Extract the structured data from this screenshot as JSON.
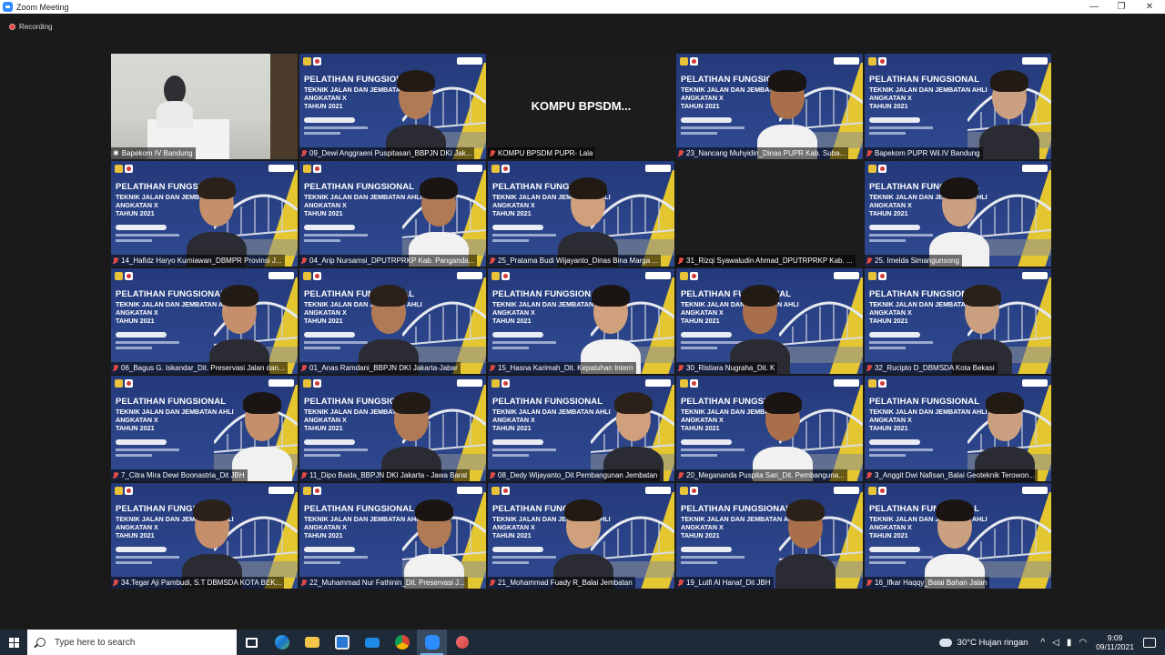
{
  "window": {
    "title": "Zoom Meeting",
    "minimize": "—",
    "restore": "❐",
    "close": "✕"
  },
  "recording": {
    "label": "Recording"
  },
  "slide": {
    "title": "PELATIHAN FUNGSIONAL",
    "line1": "TEKNIK JALAN DAN JEMBATAN AHLI",
    "line2": "ANGKATAN X",
    "line3": "TAHUN 2021"
  },
  "tiles": [
    {
      "name": "Bapekom IV Bandung",
      "type": "room",
      "active": true
    },
    {
      "name": "09_Dewi Anggraeni  Puspitasari_BBPJN DKI Jak...",
      "type": "slide"
    },
    {
      "name": "KOMPU BPSDM PUPR- Lala",
      "type": "blank",
      "center": "KOMPU  BPSDM..."
    },
    {
      "name": "23_Nancang Muhyidin_Dinas PUPR Kab. Suba...",
      "type": "slide"
    },
    {
      "name": "Bapekom PUPR Wil.IV Bandung",
      "type": "slide"
    },
    {
      "name": "14_Hafidz Haryo Kurniawan_DBMPR Provinsi J...",
      "type": "slide"
    },
    {
      "name": "04_Arip Nursamsi_DPUTRPRKP Kab. Panganda...",
      "type": "slide"
    },
    {
      "name": "25_Pratama Budi Wijayanto_Dinas Bina Marga ...",
      "type": "slide"
    },
    {
      "name": "31_Rizqi Syawaludin Ahmad_DPUTRPRKP Kab. ...",
      "type": "blank",
      "center": ""
    },
    {
      "name": "25. Imelda Simangunsong",
      "type": "slide"
    },
    {
      "name": "06_Bagus G. Iskandar_Dit. Preservasi Jalan dan...",
      "type": "slide"
    },
    {
      "name": "01_Anas Ramdani_BBPJN DKI Jakarta-Jabar",
      "type": "slide"
    },
    {
      "name": "15_Hasna Karimah_Dit. Kepatuhan Intern",
      "type": "slide"
    },
    {
      "name": "30_Ristiara Nugraha_Dit. K",
      "type": "slide"
    },
    {
      "name": "32_Rucipto D_DBMSDA Kota Bekasi",
      "type": "slide"
    },
    {
      "name": "7_Citra Mira Dewi Boonastria_Dit JBH",
      "type": "slide"
    },
    {
      "name": "11_Dipo Baida_BBPJN DKI Jakarta - Jawa Barat",
      "type": "slide"
    },
    {
      "name": "08_Dedy Wijayanto_Dit Pembangunan Jembatan",
      "type": "slide"
    },
    {
      "name": "20_Megananda Puspita Sari_Dit. Pembanguna...",
      "type": "slide"
    },
    {
      "name": "3_Anggit Dwi Nafisan_Balai Geoteknik Terowon...",
      "type": "slide"
    },
    {
      "name": "34.Tegar Aji Pambudi, S.T DBMSDA KOTA BEK...",
      "type": "slide"
    },
    {
      "name": "22_Muhammad Nur Fathinin_Dit. Preservasi J...",
      "type": "slide"
    },
    {
      "name": "21_Mohammad Fuady R_Balai Jembatan",
      "type": "slide"
    },
    {
      "name": "19_Lutfi Al Hanaf_Dit JBH",
      "type": "slide"
    },
    {
      "name": "16_Ifkar Haqqy_Balai Bahan Jalan",
      "type": "slide"
    }
  ],
  "taskbar": {
    "search_placeholder": "Type here to search",
    "weather": "30°C  Hujan ringan",
    "time": "9:09",
    "date": "09/11/2021"
  },
  "colors": {
    "accent_active": "#e6df3c",
    "slide_blue": "#2b4489",
    "muted_red": "#e24b44",
    "taskbar": "#1f2a38"
  }
}
